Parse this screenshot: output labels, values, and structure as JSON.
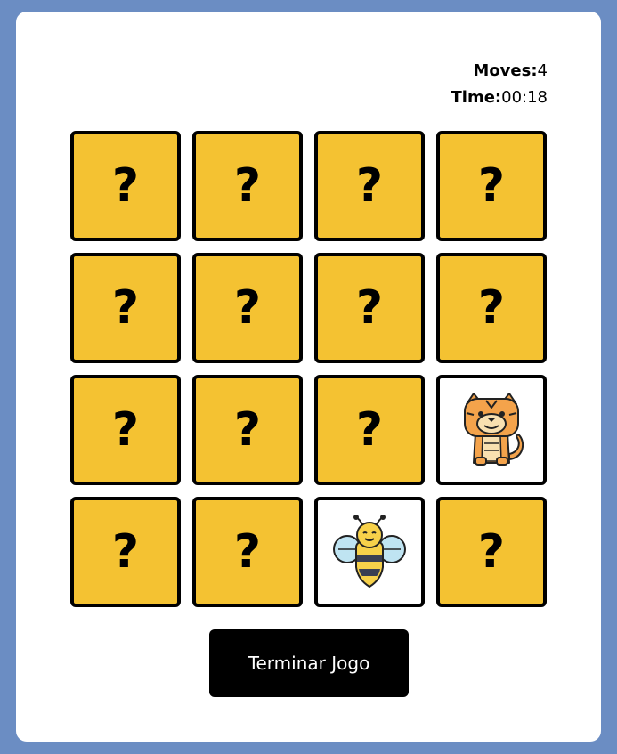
{
  "stats": {
    "moves_label": "Moves:",
    "moves_value": "4",
    "time_label": "Time:",
    "time_value": "00:18"
  },
  "cards": [
    {
      "state": "hidden",
      "text": "?"
    },
    {
      "state": "hidden",
      "text": "?"
    },
    {
      "state": "hidden",
      "text": "?"
    },
    {
      "state": "hidden",
      "text": "?"
    },
    {
      "state": "hidden",
      "text": "?"
    },
    {
      "state": "hidden",
      "text": "?"
    },
    {
      "state": "hidden",
      "text": "?"
    },
    {
      "state": "hidden",
      "text": "?"
    },
    {
      "state": "hidden",
      "text": "?"
    },
    {
      "state": "hidden",
      "text": "?"
    },
    {
      "state": "hidden",
      "text": "?"
    },
    {
      "state": "revealed",
      "icon": "tiger-icon"
    },
    {
      "state": "hidden",
      "text": "?"
    },
    {
      "state": "hidden",
      "text": "?"
    },
    {
      "state": "revealed",
      "icon": "bee-icon"
    },
    {
      "state": "hidden",
      "text": "?"
    }
  ],
  "colors": {
    "background": "#6b8dc3",
    "card_hidden": "#f4c232",
    "card_revealed": "#ffffff",
    "button": "#000000"
  },
  "button": {
    "label": "Terminar Jogo"
  }
}
